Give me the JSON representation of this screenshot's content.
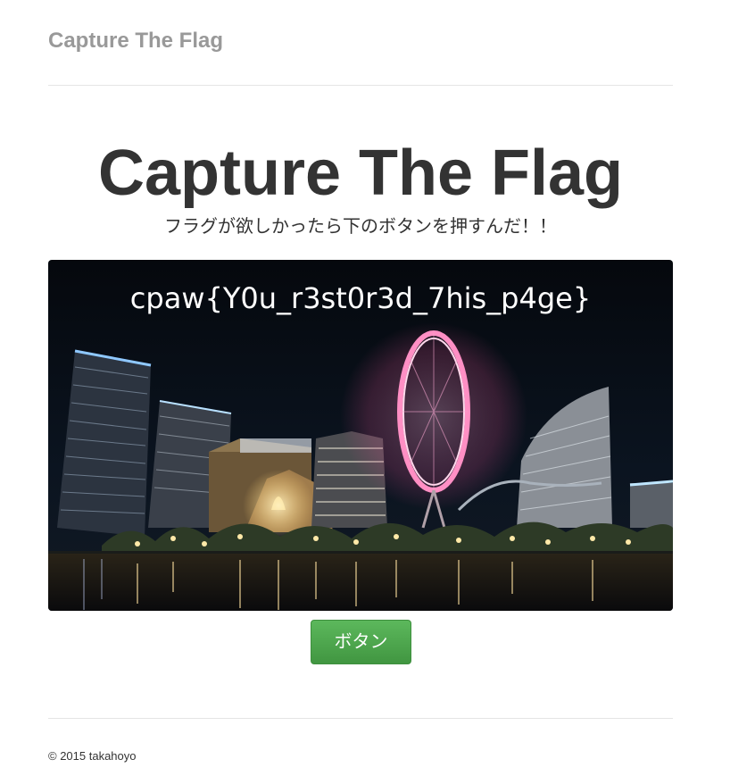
{
  "header": {
    "brand": "Capture The Flag"
  },
  "jumbotron": {
    "title": "Capture The Flag",
    "lead": "フラグが欲しかったら下のボタンを押すんだ！！"
  },
  "image": {
    "overlay_text": "cpaw{Y0u_r3st0r3d_7his_p4ge}"
  },
  "button": {
    "label": "ボタン",
    "color": "#5cb85c"
  },
  "footer": {
    "copyright": "© 2015 takahoyo"
  },
  "colors": {
    "brand_text": "#999999",
    "body_text": "#333333",
    "divider": "#e5e5e5"
  }
}
